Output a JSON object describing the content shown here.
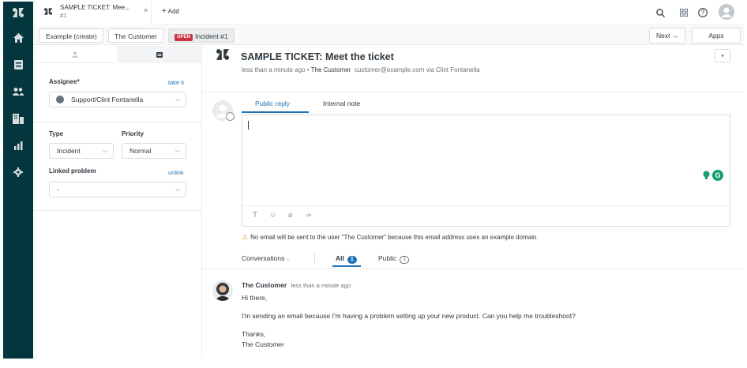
{
  "colors": {
    "nav_bg": "#03363d",
    "accent": "#1f73b7",
    "open_badge": "#cc3340",
    "warning": "#ed961c"
  },
  "nav": {
    "icons": [
      "zendesk-logo-icon",
      "home-icon",
      "views-icon",
      "customers-icon",
      "organizations-icon",
      "reporting-icon",
      "admin-gear-icon"
    ]
  },
  "topbar": {
    "tab_title": "SAMPLE TICKET: Mee...",
    "tab_sub": "#1",
    "add_label": "Add",
    "icons": [
      "search-icon",
      "products-grid-icon",
      "help-icon",
      "user-avatar"
    ]
  },
  "crumbs": {
    "items": [
      "Example (create)",
      "The Customer",
      "Incident #1"
    ],
    "open_badge": "OPEN",
    "next_label": "Next",
    "apps_label": "Apps"
  },
  "left_panel": {
    "assignee_label": "Assignee*",
    "take_it": "take it",
    "assignee_value": "Support/Clint Fontanella",
    "type_label": "Type",
    "type_value": "Incident",
    "priority_label": "Priority",
    "priority_value": "Normal",
    "linked_label": "Linked problem",
    "unlink": "unlink",
    "linked_value": "-"
  },
  "ticket": {
    "title": "SAMPLE TICKET: Meet the ticket",
    "time": "less than a minute ago",
    "requester": "The Customer",
    "email_via": "customer@example.com via Clint Fontanella"
  },
  "reply": {
    "tab_public": "Public reply",
    "tab_internal": "Internal note",
    "warning": "No email will be sent to the user \"The Customer\" because this email address uses an example domain."
  },
  "filters": {
    "conversations": "Conversations",
    "all": "All",
    "all_count": "1",
    "public": "Public",
    "public_count": "1"
  },
  "message": {
    "author": "The Customer",
    "time": "less than a minute ago",
    "line1": "Hi there,",
    "line2": "I'm sending an email because I'm having a problem setting up your new product. Can you help me troubleshoot?",
    "line3": "Thanks,",
    "line4": "The Customer"
  }
}
